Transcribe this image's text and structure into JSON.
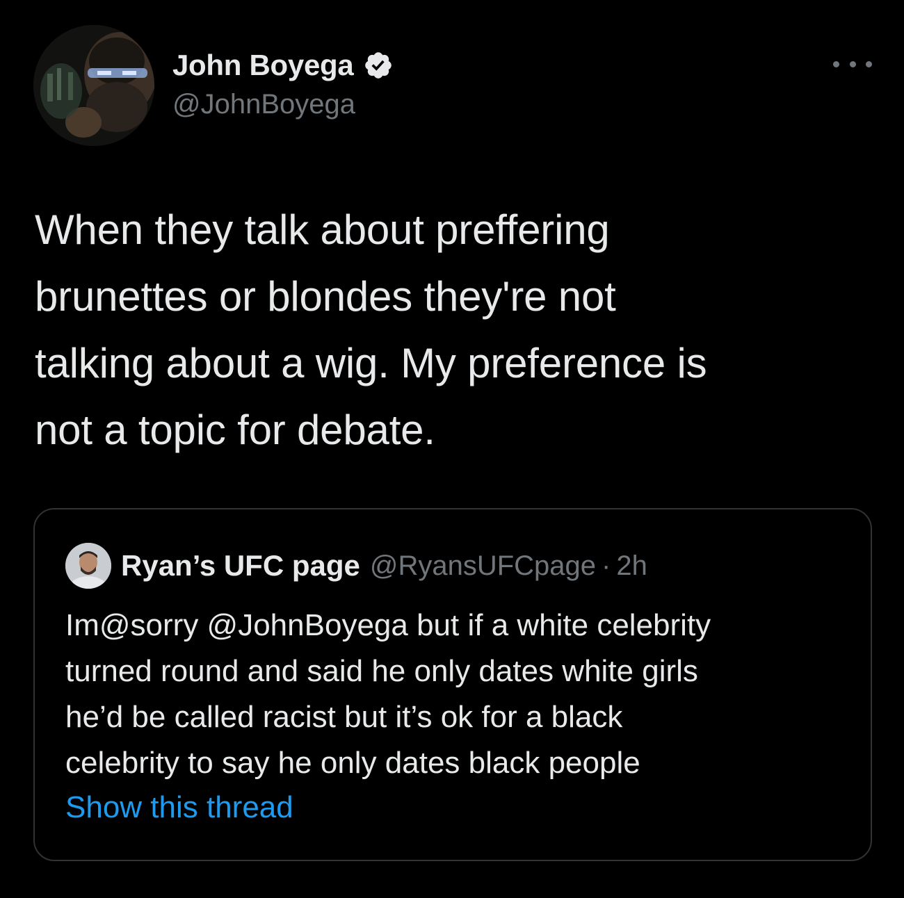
{
  "author": {
    "display_name": "John Boyega",
    "handle": "@JohnBoyega",
    "verified": true
  },
  "tweet": {
    "text": "When they talk about preffering\nbrunettes or blondes they're not\ntalking about a wig. My preference is\nnot a topic for debate."
  },
  "quoted_tweet": {
    "display_name": "Ryan’s UFC page",
    "handle": "@RyansUFCpage",
    "separator": "·",
    "time": "2h",
    "text": "Im@sorry @JohnBoyega but if a white celebrity\nturned round and said he only dates white girls\nhe’d be called racist but it’s ok for a black\ncelebrity to say he only dates black people",
    "show_thread_label": "Show this thread"
  },
  "icons": {
    "verified": "verified-badge-icon",
    "more": "more-options-icon"
  },
  "colors": {
    "background": "#000000",
    "text_primary": "#e7e9ea",
    "text_secondary": "#71767b",
    "link": "#1d9bf0",
    "border": "#2f3336"
  }
}
